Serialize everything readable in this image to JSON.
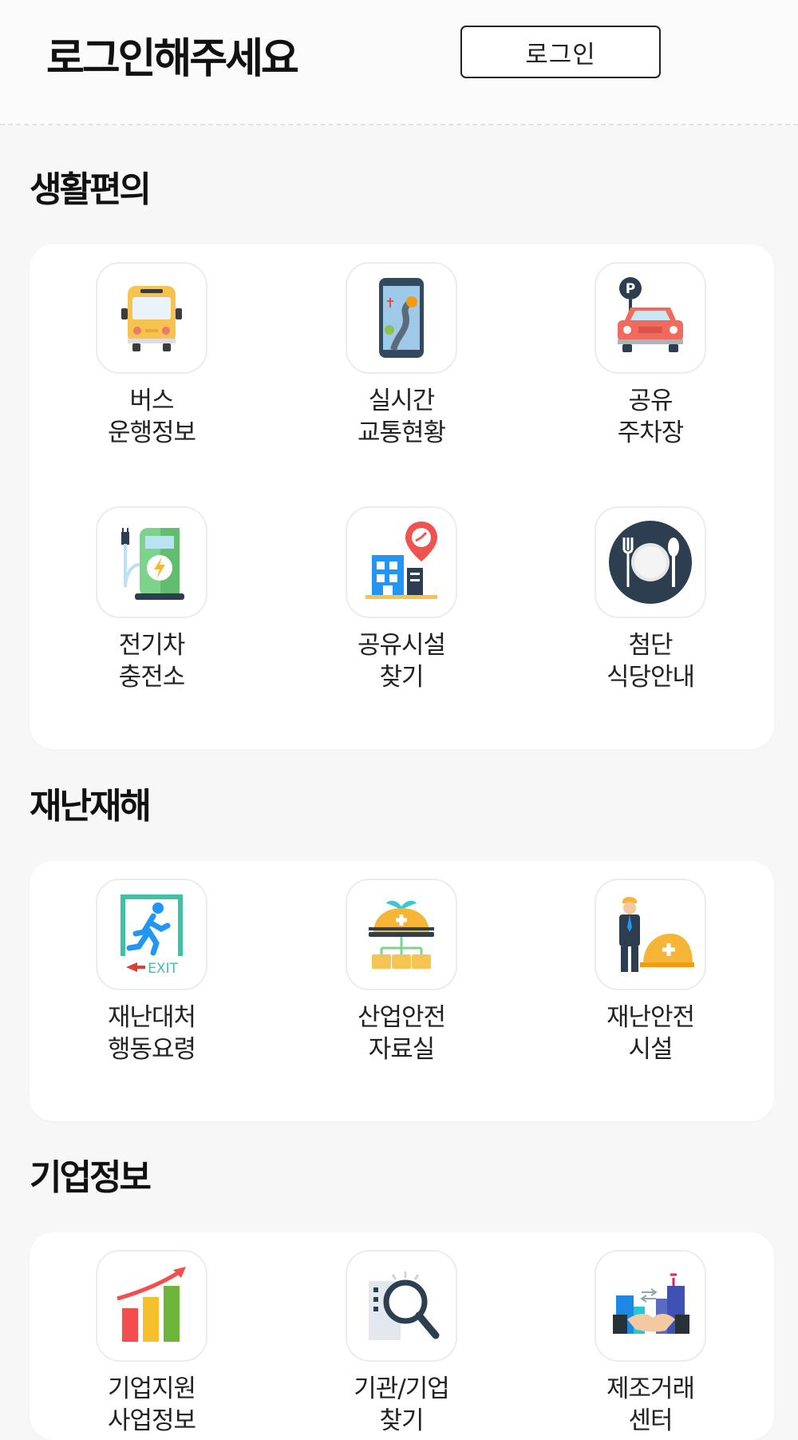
{
  "header": {
    "title": "로그인해주세요",
    "login_label": "로그인"
  },
  "sections": [
    {
      "title": "생활편의",
      "items": [
        {
          "line1": "버스",
          "line2": "운행정보",
          "icon": "bus-icon"
        },
        {
          "line1": "실시간",
          "line2": "교통현황",
          "icon": "traffic-phone-icon"
        },
        {
          "line1": "공유",
          "line2": "주차장",
          "icon": "parking-car-icon"
        },
        {
          "line1": "전기차",
          "line2": "충전소",
          "icon": "ev-charger-icon"
        },
        {
          "line1": "공유시설",
          "line2": "찾기",
          "icon": "building-location-icon"
        },
        {
          "line1": "첨단",
          "line2": "식당안내",
          "icon": "dining-plate-icon"
        }
      ]
    },
    {
      "title": "재난재해",
      "items": [
        {
          "line1": "재난대처",
          "line2": "행동요령",
          "icon": "exit-door-icon"
        },
        {
          "line1": "산업안전",
          "line2": "자료실",
          "icon": "safety-helmet-folders-icon"
        },
        {
          "line1": "재난안전",
          "line2": "시설",
          "icon": "safety-worker-icon"
        }
      ]
    },
    {
      "title": "기업정보",
      "items": [
        {
          "line1": "기업지원",
          "line2": "사업정보",
          "icon": "growth-chart-icon"
        },
        {
          "line1": "기관/기업",
          "line2": "찾기",
          "icon": "search-building-icon"
        },
        {
          "line1": "제조거래",
          "line2": "센터",
          "icon": "handshake-factory-icon"
        }
      ]
    }
  ]
}
